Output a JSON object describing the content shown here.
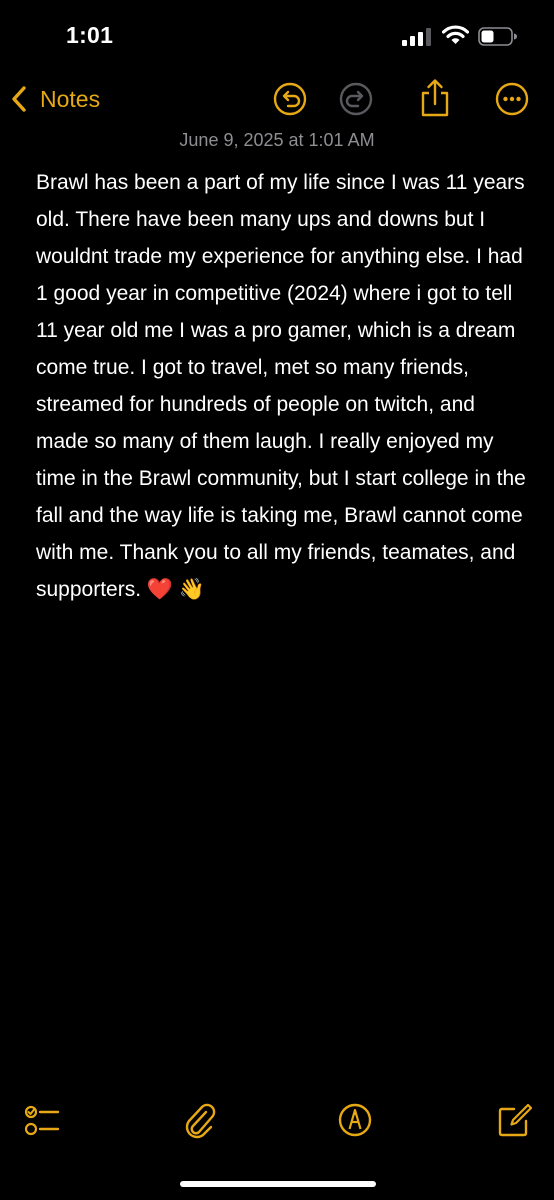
{
  "status_bar": {
    "time": "1:01"
  },
  "nav": {
    "back_label": "Notes",
    "icons": [
      "chevron-left-icon",
      "undo-icon",
      "redo-icon",
      "share-icon",
      "more-icon"
    ]
  },
  "note": {
    "date": "June 9, 2025 at 1:01 AM",
    "body": "Brawl has been a part of my life since I was 11 years old. There have been many ups and downs but I wouldnt trade my experience for anything else. I had 1 good year in competitive (2024) where i got to tell 11 year old me I was a pro gamer, which is a dream come true. I got to travel, met so many friends, streamed for hundreds of people on twitch, and made so many of them laugh. I really enjoyed my time in the Brawl community, but I start college in the fall and the way life is taking me, Brawl cannot come with me. Thank you to all my friends, teamates, and supporters. ❤️ 👋"
  },
  "toolbar": {
    "icons": [
      "checklist-icon",
      "paperclip-icon",
      "markup-icon",
      "compose-icon"
    ]
  },
  "colors": {
    "accent": "#e6a814",
    "background": "#000000",
    "text": "#ffffff",
    "secondary_text": "#8e8e93"
  }
}
